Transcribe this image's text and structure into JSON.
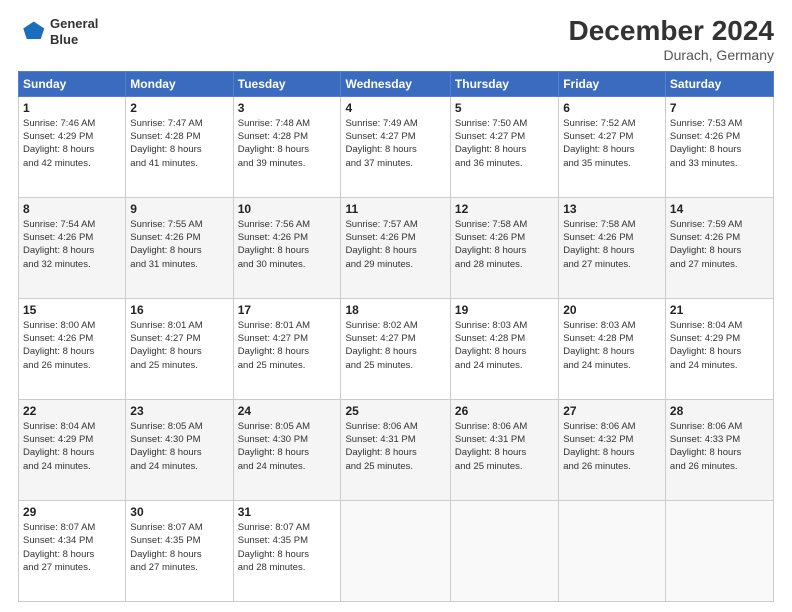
{
  "header": {
    "logo_line1": "General",
    "logo_line2": "Blue",
    "title": "December 2024",
    "subtitle": "Durach, Germany"
  },
  "days_of_week": [
    "Sunday",
    "Monday",
    "Tuesday",
    "Wednesday",
    "Thursday",
    "Friday",
    "Saturday"
  ],
  "weeks": [
    [
      {
        "day": "1",
        "info": "Sunrise: 7:46 AM\nSunset: 4:29 PM\nDaylight: 8 hours\nand 42 minutes."
      },
      {
        "day": "2",
        "info": "Sunrise: 7:47 AM\nSunset: 4:28 PM\nDaylight: 8 hours\nand 41 minutes."
      },
      {
        "day": "3",
        "info": "Sunrise: 7:48 AM\nSunset: 4:28 PM\nDaylight: 8 hours\nand 39 minutes."
      },
      {
        "day": "4",
        "info": "Sunrise: 7:49 AM\nSunset: 4:27 PM\nDaylight: 8 hours\nand 37 minutes."
      },
      {
        "day": "5",
        "info": "Sunrise: 7:50 AM\nSunset: 4:27 PM\nDaylight: 8 hours\nand 36 minutes."
      },
      {
        "day": "6",
        "info": "Sunrise: 7:52 AM\nSunset: 4:27 PM\nDaylight: 8 hours\nand 35 minutes."
      },
      {
        "day": "7",
        "info": "Sunrise: 7:53 AM\nSunset: 4:26 PM\nDaylight: 8 hours\nand 33 minutes."
      }
    ],
    [
      {
        "day": "8",
        "info": "Sunrise: 7:54 AM\nSunset: 4:26 PM\nDaylight: 8 hours\nand 32 minutes."
      },
      {
        "day": "9",
        "info": "Sunrise: 7:55 AM\nSunset: 4:26 PM\nDaylight: 8 hours\nand 31 minutes."
      },
      {
        "day": "10",
        "info": "Sunrise: 7:56 AM\nSunset: 4:26 PM\nDaylight: 8 hours\nand 30 minutes."
      },
      {
        "day": "11",
        "info": "Sunrise: 7:57 AM\nSunset: 4:26 PM\nDaylight: 8 hours\nand 29 minutes."
      },
      {
        "day": "12",
        "info": "Sunrise: 7:58 AM\nSunset: 4:26 PM\nDaylight: 8 hours\nand 28 minutes."
      },
      {
        "day": "13",
        "info": "Sunrise: 7:58 AM\nSunset: 4:26 PM\nDaylight: 8 hours\nand 27 minutes."
      },
      {
        "day": "14",
        "info": "Sunrise: 7:59 AM\nSunset: 4:26 PM\nDaylight: 8 hours\nand 27 minutes."
      }
    ],
    [
      {
        "day": "15",
        "info": "Sunrise: 8:00 AM\nSunset: 4:26 PM\nDaylight: 8 hours\nand 26 minutes."
      },
      {
        "day": "16",
        "info": "Sunrise: 8:01 AM\nSunset: 4:27 PM\nDaylight: 8 hours\nand 25 minutes."
      },
      {
        "day": "17",
        "info": "Sunrise: 8:01 AM\nSunset: 4:27 PM\nDaylight: 8 hours\nand 25 minutes."
      },
      {
        "day": "18",
        "info": "Sunrise: 8:02 AM\nSunset: 4:27 PM\nDaylight: 8 hours\nand 25 minutes."
      },
      {
        "day": "19",
        "info": "Sunrise: 8:03 AM\nSunset: 4:28 PM\nDaylight: 8 hours\nand 24 minutes."
      },
      {
        "day": "20",
        "info": "Sunrise: 8:03 AM\nSunset: 4:28 PM\nDaylight: 8 hours\nand 24 minutes."
      },
      {
        "day": "21",
        "info": "Sunrise: 8:04 AM\nSunset: 4:29 PM\nDaylight: 8 hours\nand 24 minutes."
      }
    ],
    [
      {
        "day": "22",
        "info": "Sunrise: 8:04 AM\nSunset: 4:29 PM\nDaylight: 8 hours\nand 24 minutes."
      },
      {
        "day": "23",
        "info": "Sunrise: 8:05 AM\nSunset: 4:30 PM\nDaylight: 8 hours\nand 24 minutes."
      },
      {
        "day": "24",
        "info": "Sunrise: 8:05 AM\nSunset: 4:30 PM\nDaylight: 8 hours\nand 24 minutes."
      },
      {
        "day": "25",
        "info": "Sunrise: 8:06 AM\nSunset: 4:31 PM\nDaylight: 8 hours\nand 25 minutes."
      },
      {
        "day": "26",
        "info": "Sunrise: 8:06 AM\nSunset: 4:31 PM\nDaylight: 8 hours\nand 25 minutes."
      },
      {
        "day": "27",
        "info": "Sunrise: 8:06 AM\nSunset: 4:32 PM\nDaylight: 8 hours\nand 26 minutes."
      },
      {
        "day": "28",
        "info": "Sunrise: 8:06 AM\nSunset: 4:33 PM\nDaylight: 8 hours\nand 26 minutes."
      }
    ],
    [
      {
        "day": "29",
        "info": "Sunrise: 8:07 AM\nSunset: 4:34 PM\nDaylight: 8 hours\nand 27 minutes."
      },
      {
        "day": "30",
        "info": "Sunrise: 8:07 AM\nSunset: 4:35 PM\nDaylight: 8 hours\nand 27 minutes."
      },
      {
        "day": "31",
        "info": "Sunrise: 8:07 AM\nSunset: 4:35 PM\nDaylight: 8 hours\nand 28 minutes."
      },
      {
        "day": "",
        "info": ""
      },
      {
        "day": "",
        "info": ""
      },
      {
        "day": "",
        "info": ""
      },
      {
        "day": "",
        "info": ""
      }
    ]
  ]
}
